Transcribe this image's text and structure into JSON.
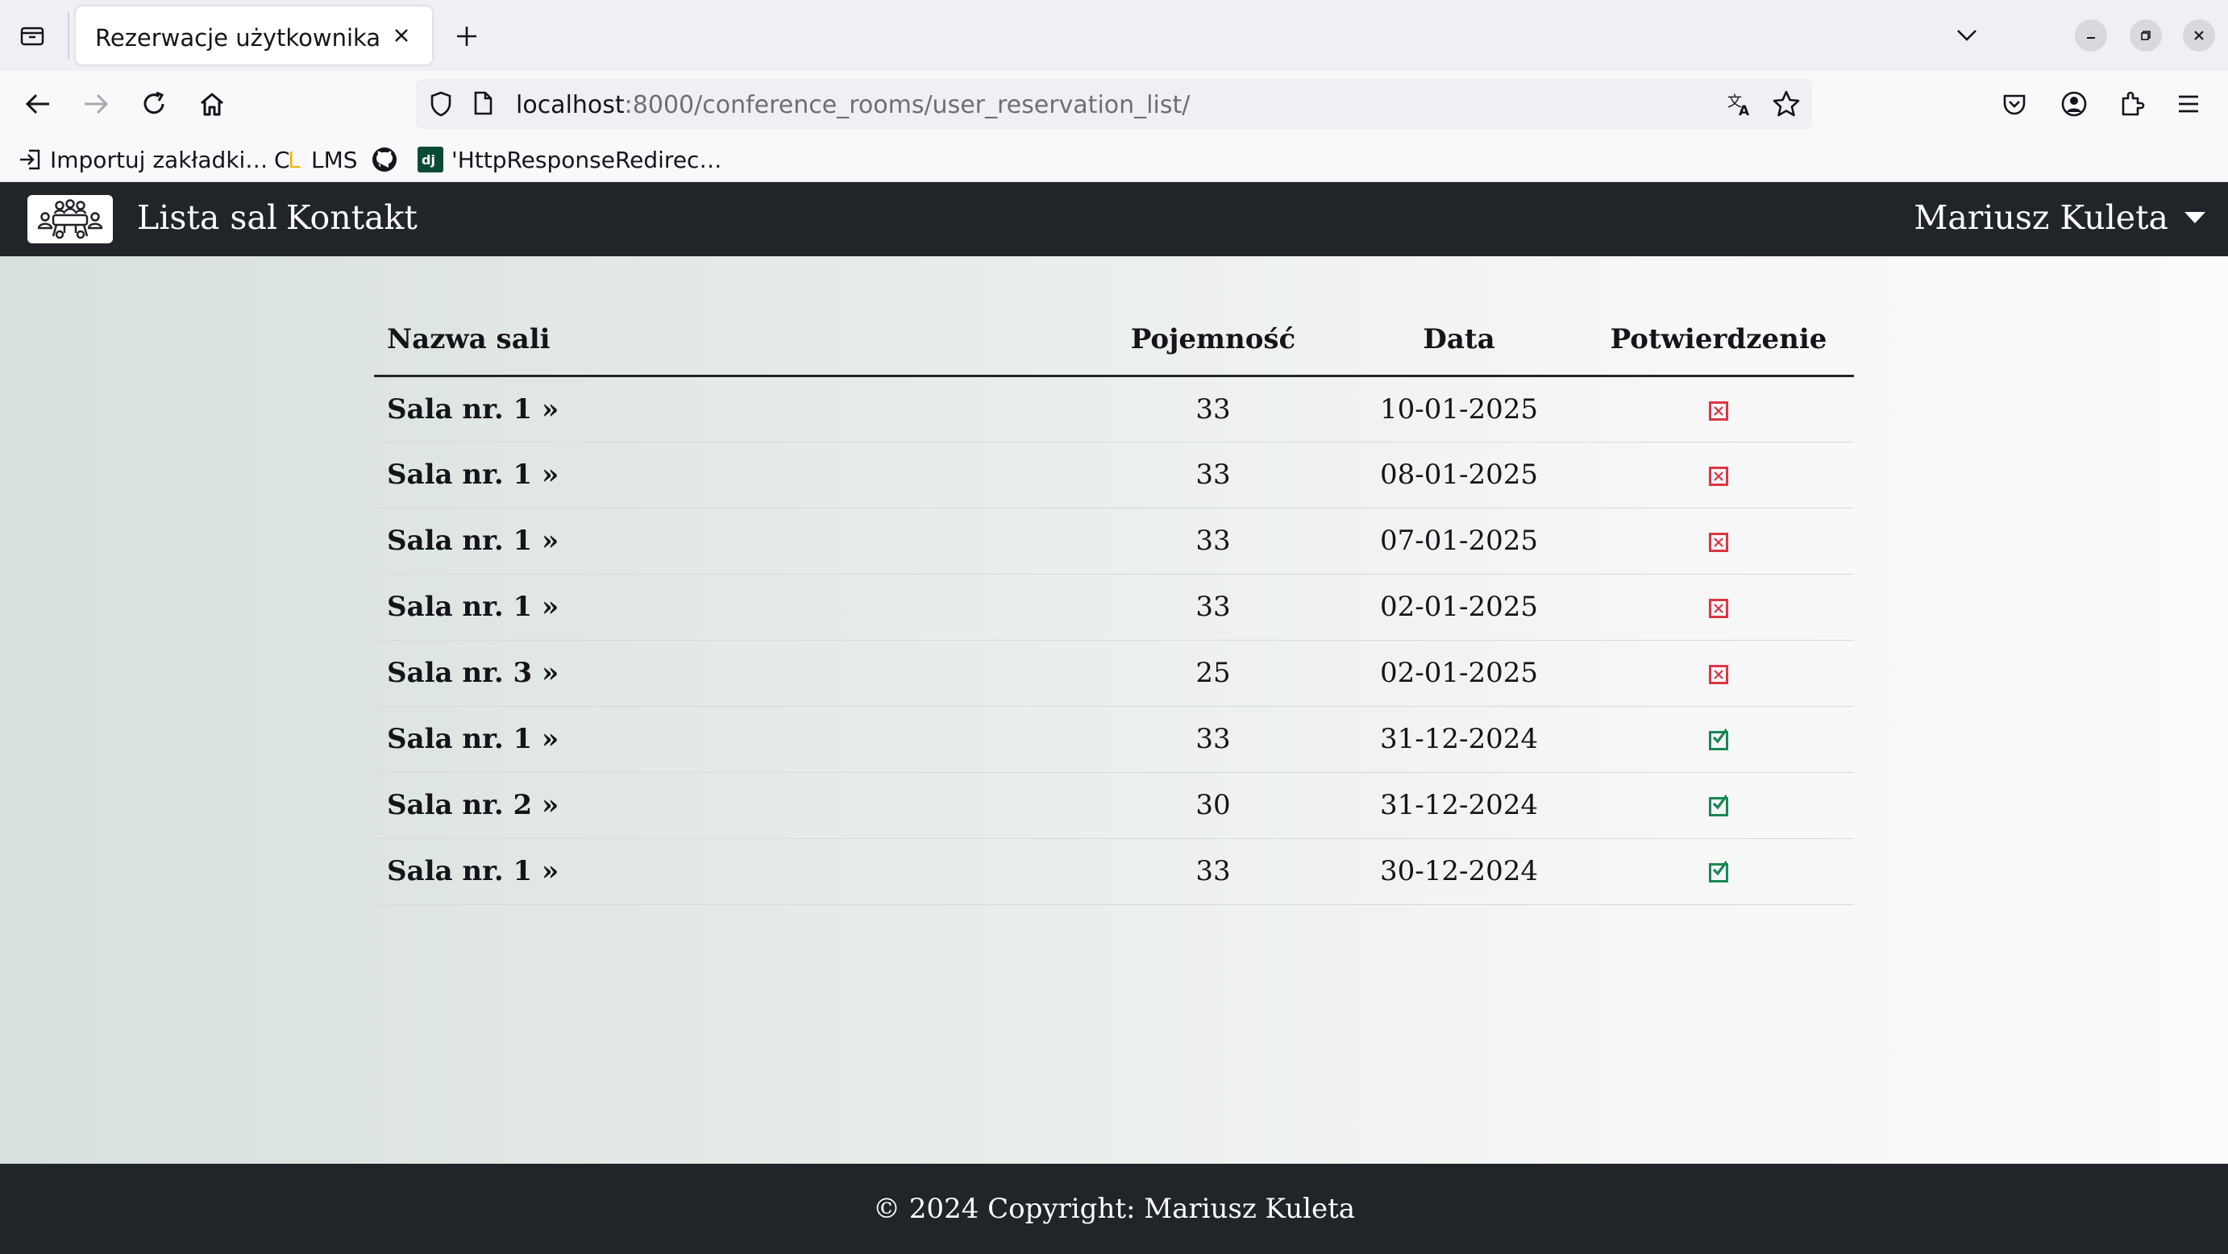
{
  "browser": {
    "tab_title": "Rezerwacje użytkownika",
    "url_host": "localhost",
    "url_rest": ":8000/conference_rooms/user_reservation_list/",
    "bookmarks": [
      {
        "label": "Importuj zakładki…",
        "icon": "import-icon"
      },
      {
        "label": "LMS",
        "icon": "cl-logo-icon"
      },
      {
        "label": "",
        "icon": "github-icon"
      },
      {
        "label": "'HttpResponseRedirec…",
        "icon": "django-icon"
      }
    ]
  },
  "site_nav": {
    "links": [
      "Lista sal",
      "Kontakt"
    ],
    "user": "Mariusz Kuleta"
  },
  "table": {
    "headers": {
      "name": "Nazwa sali",
      "capacity": "Pojemność",
      "date": "Data",
      "confirmed": "Potwierdzenie"
    },
    "rows": [
      {
        "name": "Sala nr. 1 »",
        "capacity": "33",
        "date": "10-01-2025",
        "confirmed": false
      },
      {
        "name": "Sala nr. 1 »",
        "capacity": "33",
        "date": "08-01-2025",
        "confirmed": false
      },
      {
        "name": "Sala nr. 1 »",
        "capacity": "33",
        "date": "07-01-2025",
        "confirmed": false
      },
      {
        "name": "Sala nr. 1 »",
        "capacity": "33",
        "date": "02-01-2025",
        "confirmed": false
      },
      {
        "name": "Sala nr. 3 »",
        "capacity": "25",
        "date": "02-01-2025",
        "confirmed": false
      },
      {
        "name": "Sala nr. 1 »",
        "capacity": "33",
        "date": "31-12-2024",
        "confirmed": true
      },
      {
        "name": "Sala nr. 2 »",
        "capacity": "30",
        "date": "31-12-2024",
        "confirmed": true
      },
      {
        "name": "Sala nr. 1 »",
        "capacity": "33",
        "date": "30-12-2024",
        "confirmed": true
      }
    ]
  },
  "footer": {
    "text": "© 2024 Copyright: Mariusz Kuleta"
  },
  "colors": {
    "navbar": "#212529",
    "unconfirmed": "#dc3545",
    "confirmed": "#198754"
  }
}
